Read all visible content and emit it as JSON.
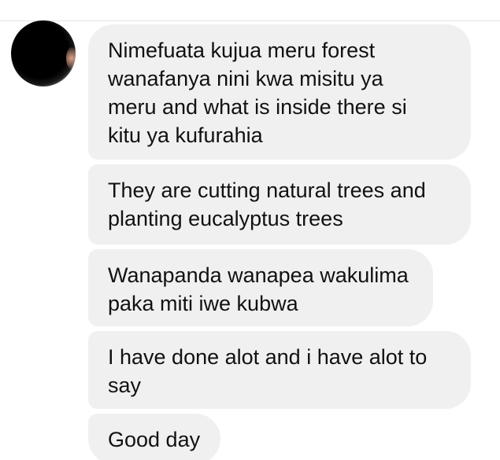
{
  "messages": [
    {
      "text": "Nimefuata kujua meru forest\nwanafanya nini kwa misitu ya\nmeru and what is inside there si\nkitu ya kufurahia"
    },
    {
      "text": "They are cutting natural trees and\nplanting eucalyptus trees"
    },
    {
      "text": "Wanapanda wanapea wakulima\npaka miti iwe kubwa"
    },
    {
      "text": "I have done alot and i have alot to\nsay"
    },
    {
      "text": "Good day"
    }
  ],
  "colors": {
    "bubble": "#f1f0f0",
    "text": "#111111",
    "background": "#ffffff"
  },
  "icons": {
    "avatar": "blurred-avatar"
  }
}
